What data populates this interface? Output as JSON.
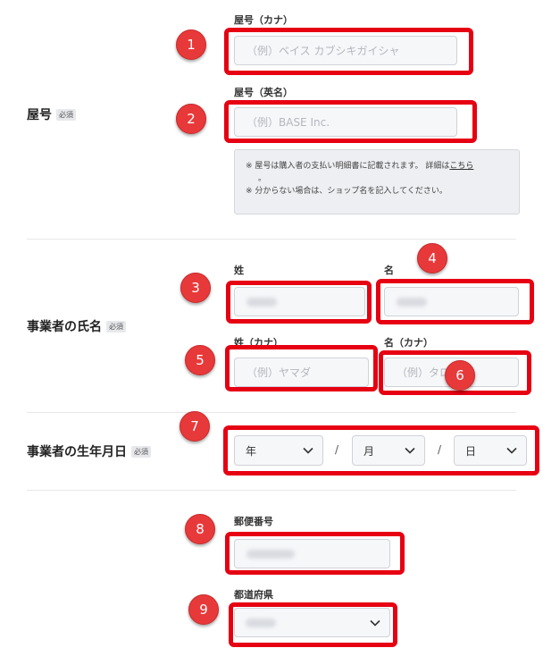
{
  "shop_name": {
    "label": "屋号",
    "required_badge": "必須",
    "kana": {
      "label": "屋号（カナ）",
      "placeholder": "（例）ベイス カブシキガイシャ"
    },
    "english": {
      "label": "屋号（英名）",
      "placeholder": "（例）BASE Inc."
    },
    "notice": {
      "line1_prefix": "※ 屋号は購入者の支払い明細書に記載されます。 詳細は",
      "link": "こちら",
      "line1_end": "。",
      "line2": "※ 分からない場合は、ショップ名を記入してください。"
    }
  },
  "owner_name": {
    "label": "事業者の氏名",
    "required_badge": "必須",
    "last": {
      "label": "姓"
    },
    "first": {
      "label": "名"
    },
    "last_kana": {
      "label": "姓（カナ）",
      "placeholder": "（例）ヤマダ"
    },
    "first_kana": {
      "label": "名（カナ）",
      "placeholder": "（例）タロ"
    }
  },
  "birthdate": {
    "label": "事業者の生年月日",
    "required_badge": "必須",
    "year": "年",
    "month": "月",
    "day": "日",
    "separator": "/"
  },
  "postal": {
    "label": "郵便番号"
  },
  "prefecture": {
    "label": "都道府県"
  },
  "markers": [
    "1",
    "2",
    "3",
    "4",
    "5",
    "6",
    "7",
    "8",
    "9"
  ],
  "colors": {
    "highlight": "#e60012",
    "marker": "#e8393a"
  },
  "icons": {
    "dropdown": "chevron-down-icon"
  }
}
